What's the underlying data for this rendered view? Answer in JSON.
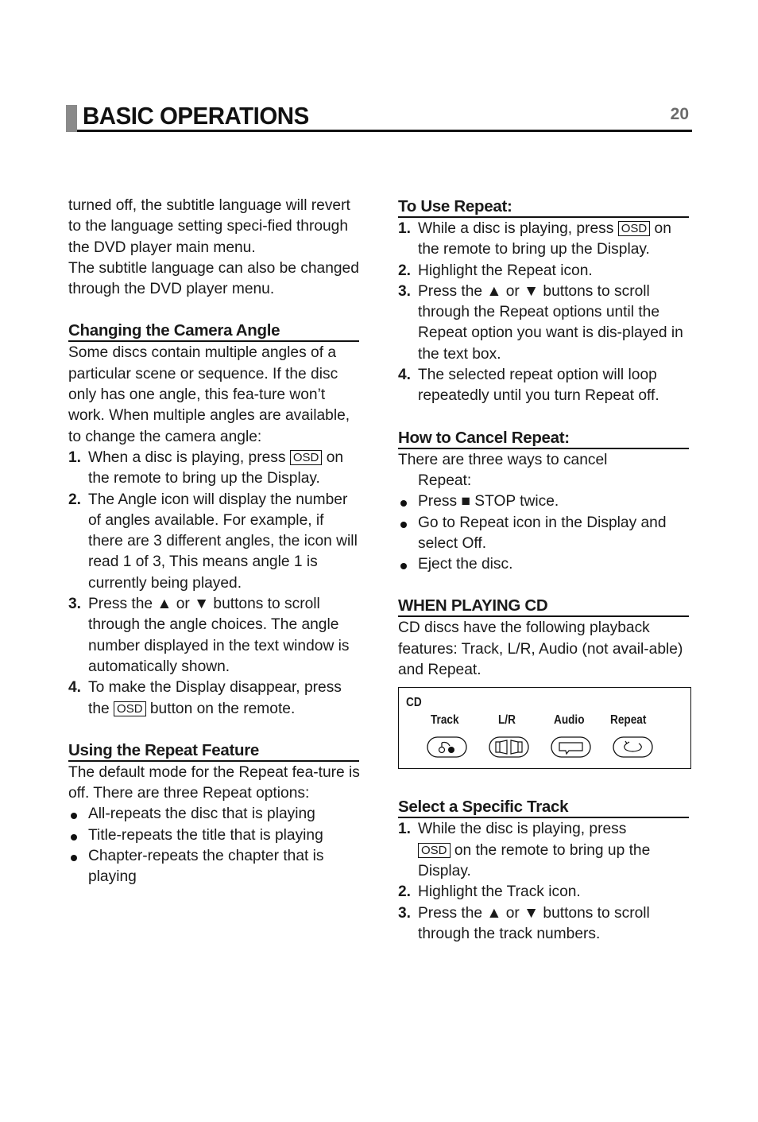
{
  "header": {
    "title": "BASIC OPERATIONS",
    "page_number": "20"
  },
  "left": {
    "intro_p1": "turned off, the subtitle language will revert to the language setting speci-fied through the DVD player main menu.",
    "intro_p2": "The subtitle language can also be changed through the DVD player menu.",
    "camera": {
      "heading": "Changing the Camera Angle",
      "body": "Some discs contain multiple angles of a particular scene or sequence. If the disc only has one angle, this fea-ture won’t work. When multiple angles are available, to change the camera angle:",
      "steps": [
        {
          "num": "1.",
          "pre": "When a disc is playing, press",
          "osd": "OSD",
          "post": "on the remote to bring up the Display."
        },
        {
          "num": "2.",
          "text": "The Angle icon will display the number of angles available. For example, if there are 3 different angles, the icon will read 1 of 3, This means angle 1 is currently being played."
        },
        {
          "num": "3.",
          "text": "Press the ▲ or ▼ buttons to scroll through the angle choices. The angle number displayed in the text window is automatically shown."
        },
        {
          "num": "4.",
          "pre": "To make the Display disappear, press the",
          "osd": "OSD",
          "post": "button on the remote."
        }
      ]
    },
    "repeat_feature": {
      "heading": "Using the Repeat Feature",
      "body": "The default mode for the Repeat fea-ture is off. There are three Repeat options:",
      "bullets": [
        "All-repeats the disc that is playing",
        "Title-repeats the title that is playing",
        "Chapter-repeats the chapter that is playing"
      ]
    }
  },
  "right": {
    "use_repeat": {
      "heading": "To Use Repeat:",
      "steps": [
        {
          "num": "1.",
          "pre": "While a disc is playing, press",
          "osd": "OSD",
          "post": "on the remote to bring up the Display."
        },
        {
          "num": "2.",
          "text": "Highlight the Repeat icon."
        },
        {
          "num": "3.",
          "text": "Press the ▲ or ▼ buttons to scroll through the Repeat options until the Repeat option you want is dis-played in the text box."
        },
        {
          "num": "4.",
          "text": "The selected repeat option will loop repeatedly until you turn Repeat off."
        }
      ]
    },
    "cancel_repeat": {
      "heading": "How to Cancel Repeat:",
      "intro_a": "There are three ways to cancel",
      "intro_b": "Repeat:",
      "bullets": [
        "Press ■ STOP twice.",
        "Go to Repeat icon in the Display and select Off.",
        "Eject the disc."
      ]
    },
    "playing_cd": {
      "heading": "WHEN PLAYING CD",
      "body": "CD discs have the following playback features: Track, L/R, Audio (not avail-able) and Repeat.",
      "panel": {
        "label": "CD",
        "items": [
          {
            "label": "Track",
            "icon": "track-icon"
          },
          {
            "label": "L/R",
            "icon": "speaker-lr-icon"
          },
          {
            "label": "Audio",
            "icon": "audio-speech-icon"
          },
          {
            "label": "Repeat",
            "icon": "repeat-icon"
          }
        ]
      }
    },
    "specific_track": {
      "heading": "Select a Specific Track",
      "steps": [
        {
          "num": "1.",
          "pre": "While the disc is playing, press",
          "osd": "OSD",
          "post": "on the remote to bring up the Display."
        },
        {
          "num": "2.",
          "text": "Highlight the Track icon."
        },
        {
          "num": "3.",
          "text": "Press the ▲ or ▼ buttons to scroll through the track numbers."
        }
      ]
    }
  }
}
